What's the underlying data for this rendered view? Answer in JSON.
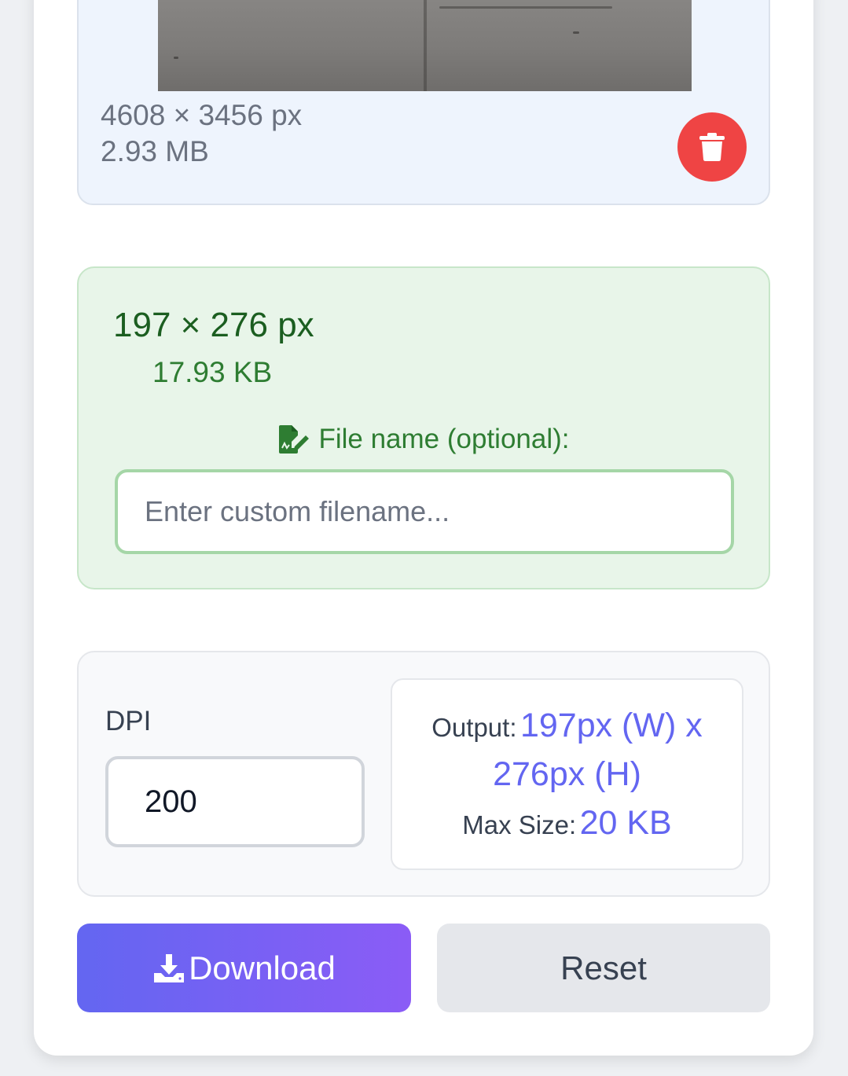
{
  "original": {
    "dimensions": "4608 × 3456 px",
    "size": "2.93 MB"
  },
  "result": {
    "dimensions": "197 × 276 px",
    "size": "17.93 KB",
    "filename_label": "File name (optional):",
    "filename_placeholder": "Enter custom filename...",
    "filename_value": ""
  },
  "settings": {
    "dpi_label": "DPI",
    "dpi_value": "200",
    "output_label": "Output:",
    "output_width": "197px (W) x",
    "output_height": "276px (H)",
    "max_size_label": "Max Size:",
    "max_size_value": "20 KB"
  },
  "actions": {
    "download_label": "Download",
    "reset_label": "Reset"
  },
  "colors": {
    "accent": "#6366f1",
    "accent_end": "#8b5cf6",
    "delete": "#ef4444",
    "success_text": "#2e7d32",
    "success_bg": "#e8f5e9"
  },
  "icons": {
    "delete": "trash-icon",
    "filename": "file-signature-icon",
    "download": "download-icon"
  }
}
